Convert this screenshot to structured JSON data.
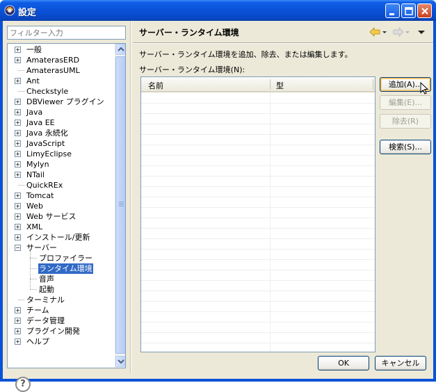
{
  "window": {
    "title": "設定"
  },
  "filter": {
    "placeholder": "フィルター入力"
  },
  "tree": [
    {
      "label": "一般",
      "level": 0,
      "expander": "+"
    },
    {
      "label": "AmaterasERD",
      "level": 0,
      "expander": "+"
    },
    {
      "label": "AmaterasUML",
      "level": 0,
      "expander": ""
    },
    {
      "label": "Ant",
      "level": 0,
      "expander": "+"
    },
    {
      "label": "Checkstyle",
      "level": 0,
      "expander": ""
    },
    {
      "label": "DBViewer プラグイン",
      "level": 0,
      "expander": "+"
    },
    {
      "label": "Java",
      "level": 0,
      "expander": "+"
    },
    {
      "label": "Java EE",
      "level": 0,
      "expander": "+"
    },
    {
      "label": "Java 永続化",
      "level": 0,
      "expander": "+"
    },
    {
      "label": "JavaScript",
      "level": 0,
      "expander": "+"
    },
    {
      "label": "LimyEclipse",
      "level": 0,
      "expander": "+"
    },
    {
      "label": "Mylyn",
      "level": 0,
      "expander": "+"
    },
    {
      "label": "NTail",
      "level": 0,
      "expander": "+"
    },
    {
      "label": "QuickREx",
      "level": 0,
      "expander": ""
    },
    {
      "label": "Tomcat",
      "level": 0,
      "expander": "+"
    },
    {
      "label": "Web",
      "level": 0,
      "expander": "+"
    },
    {
      "label": "Web サービス",
      "level": 0,
      "expander": "+"
    },
    {
      "label": "XML",
      "level": 0,
      "expander": "+"
    },
    {
      "label": "インストール/更新",
      "level": 0,
      "expander": "+"
    },
    {
      "label": "サーバー",
      "level": 0,
      "expander": "-"
    },
    {
      "label": "プロファイラー",
      "level": 1,
      "expander": ""
    },
    {
      "label": "ランタイム環境",
      "level": 1,
      "expander": "",
      "selected": true
    },
    {
      "label": "音声",
      "level": 1,
      "expander": ""
    },
    {
      "label": "起動",
      "level": 1,
      "expander": ""
    },
    {
      "label": "ターミナル",
      "level": 0,
      "expander": ""
    },
    {
      "label": "チーム",
      "level": 0,
      "expander": "+"
    },
    {
      "label": "データ管理",
      "level": 0,
      "expander": "+"
    },
    {
      "label": "プラグイン開発",
      "level": 0,
      "expander": "+"
    },
    {
      "label": "ヘルプ",
      "level": 0,
      "expander": "+"
    }
  ],
  "page": {
    "title": "サーバー・ランタイム環境",
    "description": "サーバー・ランタイム環境を追加、除去、または編集します。",
    "list_label": "サーバー・ランタイム環境(N):",
    "columns": [
      "名前",
      "型"
    ],
    "rows": []
  },
  "buttons": {
    "add": "追加(A)...",
    "edit": "編集(E)...",
    "remove": "除去(R)",
    "search": "検索(S)..."
  },
  "footer": {
    "ok": "OK",
    "cancel": "キャンセル",
    "help": "?"
  },
  "colors": {
    "title_bar": "#0a52d8",
    "selection": "#316ac5",
    "dialog_bg": "#ece9d8"
  }
}
